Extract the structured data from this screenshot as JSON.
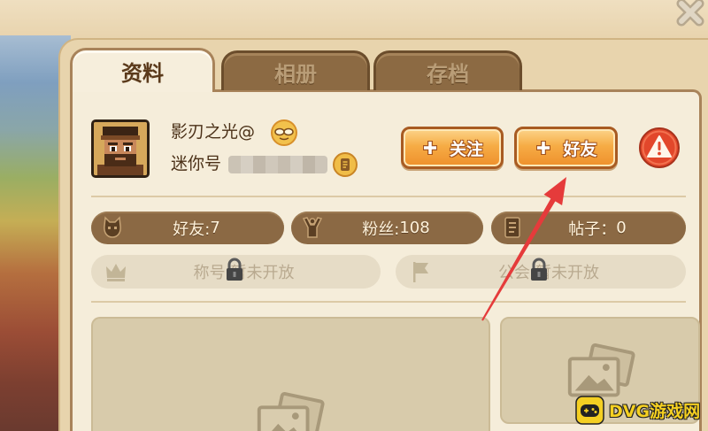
{
  "window": {
    "close_icon": "close-icon"
  },
  "tabs": [
    {
      "label": "资料",
      "active": true
    },
    {
      "label": "相册",
      "active": false
    },
    {
      "label": "存档",
      "active": false
    }
  ],
  "profile": {
    "name": "影刃之光@",
    "mini_id_label": "迷你号",
    "mini_id_value_redacted": true,
    "avatar_icon": "avatar-icon",
    "medal_icon": "medal-glasses-icon",
    "copy_icon": "copy-icon"
  },
  "actions": {
    "follow_label": "关注",
    "add_friend_label": "好友",
    "follow_icon": "plus-icon",
    "add_friend_icon": "plus-icon",
    "report_icon": "warning-icon"
  },
  "stats": [
    {
      "icon": "cat-icon",
      "label": "好友:",
      "value": "7"
    },
    {
      "icon": "hand-icon",
      "label": "粉丝:",
      "value": "108"
    },
    {
      "icon": "document-icon",
      "label": "帖子：",
      "value": "0"
    }
  ],
  "locked": [
    {
      "icon": "crown-icon",
      "label": "称号:",
      "status": "暂未开放",
      "lock_icon": "lock-icon"
    },
    {
      "icon": "flag-icon",
      "label": "公会:",
      "status": "暂未开放",
      "lock_icon": "lock-icon"
    }
  ],
  "gallery": [
    {
      "icon": "photo-icon"
    },
    {
      "icon": "photo-icon"
    }
  ],
  "annotation": {
    "type": "arrow",
    "color": "#e53b3b"
  },
  "watermark": {
    "text": "DVG游戏网",
    "icon": "gamepad-icon"
  },
  "colors": {
    "panel": "#e8d4ad",
    "content": "#f5edda",
    "tab_inactive": "#8c6a43",
    "button_orange": "#f6ac45",
    "stat_pill": "#8b6944",
    "locked_pill": "#e6dcc6",
    "report_red": "#e2472b",
    "watermark_yellow": "#f5d021"
  }
}
